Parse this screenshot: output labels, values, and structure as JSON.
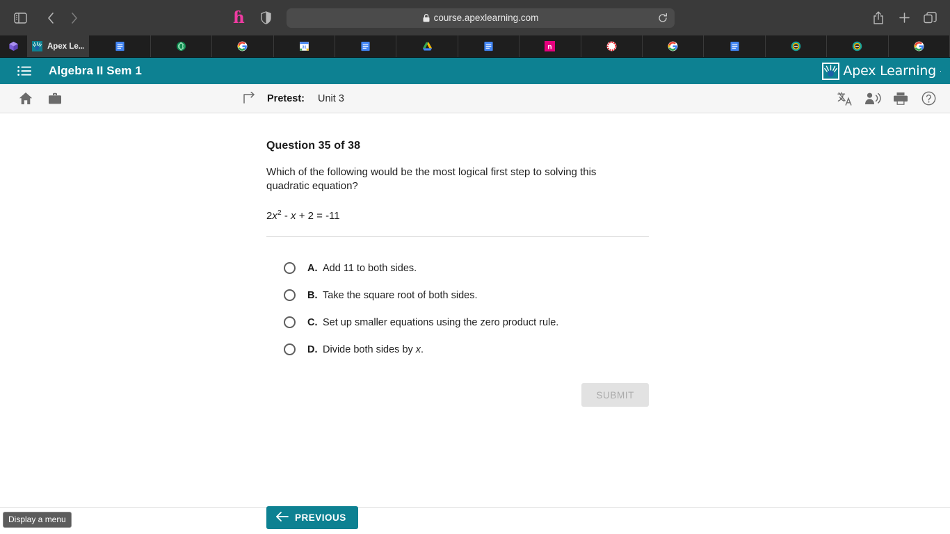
{
  "browser": {
    "url": "course.apexlearning.com",
    "toolbar_icons": {
      "sidebar": "sidebar-toggle-icon",
      "back": "back-arrow-icon",
      "forward": "forward-arrow-icon",
      "honey": "honey-extension-icon",
      "shield": "privacy-shield-icon",
      "lock": "lock-icon",
      "reload": "reload-icon",
      "share": "share-icon",
      "new_tab": "plus-icon",
      "tab_overview": "tab-overview-icon"
    },
    "tabs": [
      {
        "label": "",
        "favicon": "generic-app-icon"
      },
      {
        "label": "Apex Le...",
        "favicon": "apex-learning-icon",
        "active": true
      },
      {
        "label": "",
        "favicon": "google-docs-icon"
      },
      {
        "label": "",
        "favicon": "green-globe-icon"
      },
      {
        "label": "",
        "favicon": "google-icon"
      },
      {
        "label": "",
        "favicon": "google-calendar-icon"
      },
      {
        "label": "",
        "favicon": "google-docs-icon"
      },
      {
        "label": "",
        "favicon": "google-drive-icon"
      },
      {
        "label": "",
        "favicon": "google-docs-icon"
      },
      {
        "label": "",
        "favicon": "notion-pink-icon"
      },
      {
        "label": "",
        "favicon": "red-circle-icon"
      },
      {
        "label": "",
        "favicon": "google-icon"
      },
      {
        "label": "",
        "favicon": "google-docs-icon"
      },
      {
        "label": "",
        "favicon": "colorful-ring-icon"
      },
      {
        "label": "",
        "favicon": "colorful-ring-icon"
      },
      {
        "label": "",
        "favicon": "google-icon"
      }
    ]
  },
  "app_header": {
    "menu_icon": "hamburger-menu-icon",
    "course_title": "Algebra II Sem 1",
    "brand_name": "Apex Learning",
    "brand_tm": "™"
  },
  "sub_toolbar": {
    "home_icon": "home-icon",
    "briefcase_icon": "briefcase-icon",
    "levelup_icon": "level-up-arrow-icon",
    "activity_label": "Pretest:",
    "activity_value": "Unit 3",
    "translate_icon": "translate-icon",
    "read_aloud_icon": "read-aloud-icon",
    "print_icon": "print-icon",
    "help_icon": "help-icon"
  },
  "question": {
    "number_label": "Question 35 of 38",
    "prompt": "Which of the following would be the most logical first step to solving this quadratic equation?",
    "equation": {
      "coefficient": "2",
      "var1": "x",
      "exponent": "2",
      "mid": " - ",
      "var2": "x",
      "tail": " + 2 = -11"
    },
    "options": [
      {
        "letter": "A.",
        "text": "Add 11 to both sides.",
        "selected": false
      },
      {
        "letter": "B.",
        "text": "Take the square root of both sides.",
        "selected": false
      },
      {
        "letter": "C.",
        "text": "Set up smaller equations using the zero product rule.",
        "selected": false
      },
      {
        "letter": "D.",
        "text_before": "Divide both sides by ",
        "text_italic": "x",
        "text_after": ".",
        "text": "Divide both sides by x.",
        "selected": false
      }
    ],
    "submit_label": "SUBMIT",
    "submit_disabled": true
  },
  "footer": {
    "previous_label": "PREVIOUS",
    "previous_icon": "left-arrow-icon"
  },
  "tooltip": {
    "text": "Display a menu"
  },
  "colors": {
    "brand_teal": "#0d8192",
    "chrome_dark": "#3a3a3a",
    "tabstrip_dark": "#1e1e1e",
    "honey_pink": "#ef3ba2",
    "submit_disabled_bg": "#e2e2e2",
    "tooltip_bg": "#5c5c5c"
  }
}
